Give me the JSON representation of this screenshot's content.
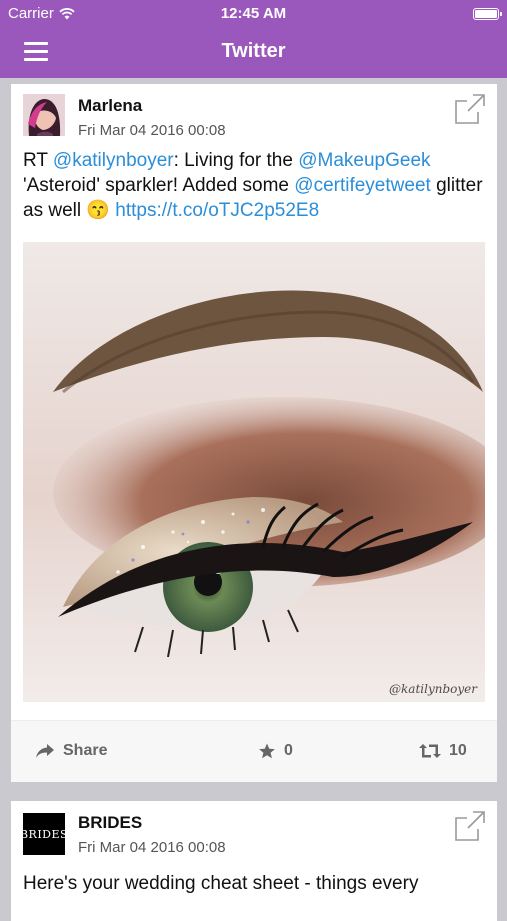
{
  "status_bar": {
    "carrier": "Carrier",
    "time": "12:45 AM"
  },
  "nav": {
    "title": "Twitter"
  },
  "colors": {
    "accent": "#9b58bc",
    "link": "#2a8ed8"
  },
  "posts": [
    {
      "author": "Marlena",
      "date": "Fri Mar 04 2016 00:08",
      "text_segments": [
        {
          "text": "RT "
        },
        {
          "text": "@katilynboyer"
        },
        {
          "text": ": Living for the "
        },
        {
          "text": "@MakeupGeek"
        },
        {
          "text": " 'Asteroid' sparkler! Added some "
        },
        {
          "text": "@certifeyetweet"
        },
        {
          "text": " glitter as well 😙 "
        },
        {
          "text": "https://t.co/oTJC2p52E8"
        }
      ],
      "image_watermark": "@katilynboyer",
      "actions": {
        "share": "Share",
        "likes": "0",
        "retweets": "10"
      }
    },
    {
      "author": "BRIDES",
      "logo_text": "BRIDES",
      "date": "Fri Mar 04 2016 00:08",
      "text": "Here's your wedding cheat sheet - things every"
    }
  ]
}
